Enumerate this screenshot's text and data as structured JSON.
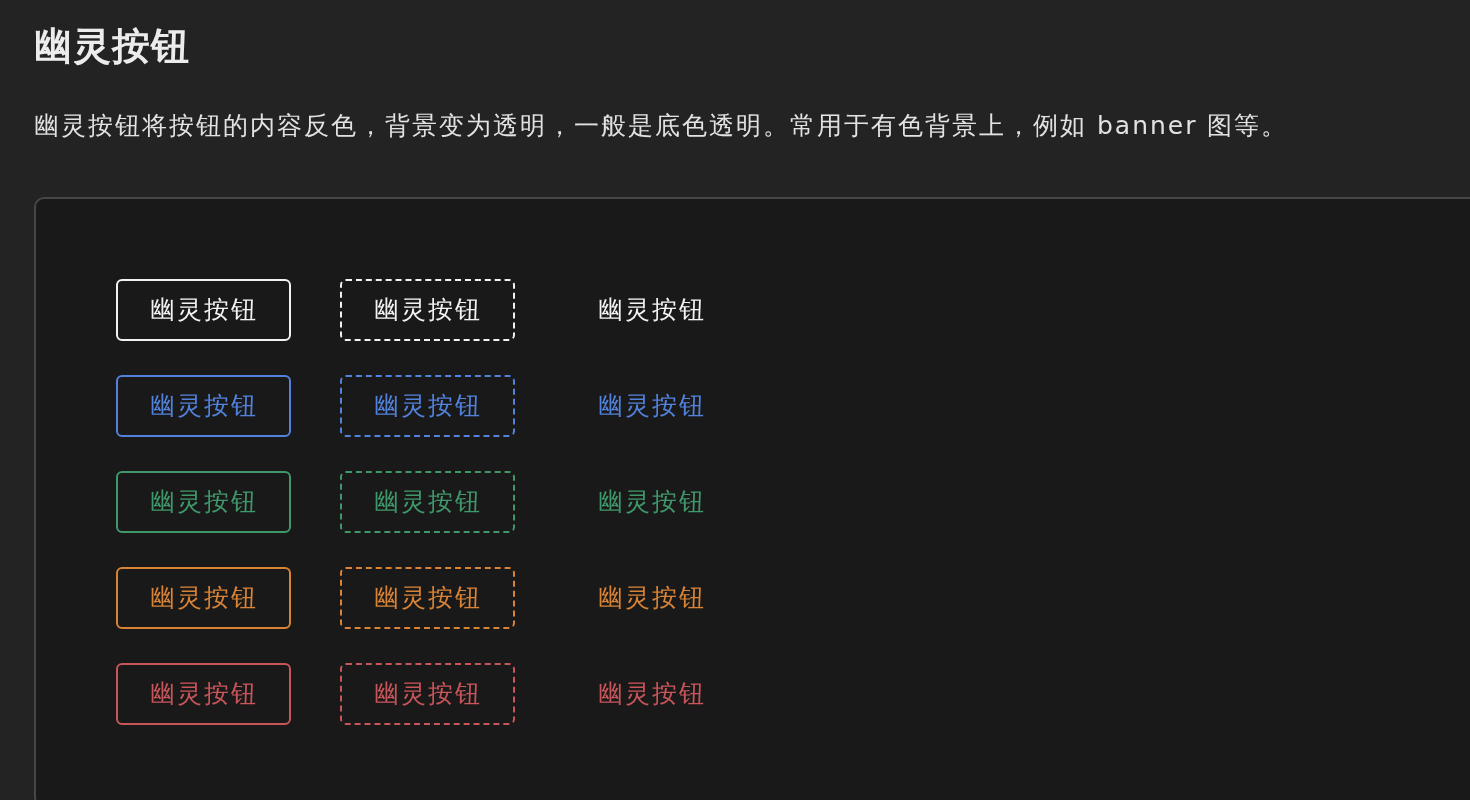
{
  "title": "幽灵按钮",
  "description": "幽灵按钮将按钮的内容反色，背景变为透明，一般是底色透明。常用于有色背景上，例如 banner 图等。",
  "demo": {
    "rows": [
      {
        "buttons": [
          {
            "kind": "solid",
            "color": "#f2f2f2",
            "label": "幽灵按钮"
          },
          {
            "kind": "dashed",
            "color": "#f2f2f2",
            "label": "幽灵按钮"
          },
          {
            "kind": "text",
            "color": "#f2f2f2",
            "label": "幽灵按钮"
          }
        ]
      },
      {
        "buttons": [
          {
            "kind": "solid",
            "color": "#5282dc",
            "label": "幽灵按钮"
          },
          {
            "kind": "dashed",
            "color": "#5282dc",
            "label": "幽灵按钮"
          },
          {
            "kind": "text",
            "color": "#5282dc",
            "label": "幽灵按钮"
          }
        ]
      },
      {
        "buttons": [
          {
            "kind": "solid",
            "color": "#40986a",
            "label": "幽灵按钮"
          },
          {
            "kind": "dashed",
            "color": "#40986a",
            "label": "幽灵按钮"
          },
          {
            "kind": "text",
            "color": "#40986a",
            "label": "幽灵按钮"
          }
        ]
      },
      {
        "buttons": [
          {
            "kind": "solid",
            "color": "#d88336",
            "label": "幽灵按钮"
          },
          {
            "kind": "dashed",
            "color": "#d88336",
            "label": "幽灵按钮"
          },
          {
            "kind": "text",
            "color": "#d88336",
            "label": "幽灵按钮"
          }
        ]
      },
      {
        "buttons": [
          {
            "kind": "solid",
            "color": "#c8555a",
            "label": "幽灵按钮"
          },
          {
            "kind": "dashed",
            "color": "#c8555a",
            "label": "幽灵按钮"
          },
          {
            "kind": "text",
            "color": "#c8555a",
            "label": "幽灵按钮"
          }
        ]
      }
    ]
  }
}
